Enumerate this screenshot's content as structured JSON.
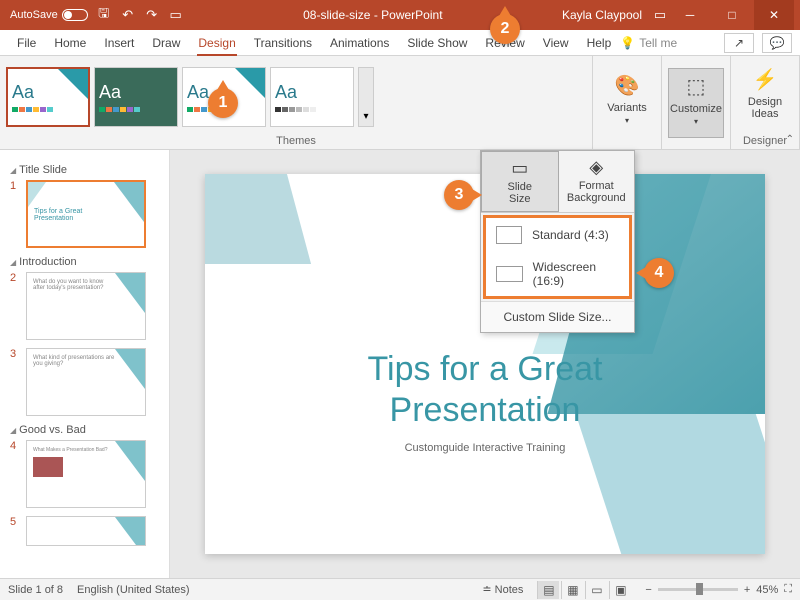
{
  "titlebar": {
    "autosave": "AutoSave",
    "doc": "08-slide-size",
    "app": "PowerPoint",
    "user": "Kayla Claypool"
  },
  "tabs": {
    "file": "File",
    "home": "Home",
    "insert": "Insert",
    "draw": "Draw",
    "design": "Design",
    "transitions": "Transitions",
    "animations": "Animations",
    "slideshow": "Slide Show",
    "review": "Review",
    "view": "View",
    "help": "Help",
    "tellme": "Tell me"
  },
  "ribbon": {
    "themes_label": "Themes",
    "variants": "Variants",
    "customize": "Customize",
    "design_ideas": "Design\nIdeas",
    "designer_label": "Designer"
  },
  "customize_menu": {
    "slide_size": "Slide\nSize",
    "format_bg": "Format\nBackground",
    "standard": "Standard (4:3)",
    "widescreen": "Widescreen (16:9)",
    "custom": "Custom Slide Size..."
  },
  "sidebar": {
    "sec1": "Title Slide",
    "sec2": "Introduction",
    "sec3": "Good vs. Bad"
  },
  "slide": {
    "title": "Tips for a Great\nPresentation",
    "subtitle": "Customguide Interactive Training"
  },
  "status": {
    "slide": "Slide 1 of 8",
    "lang": "English (United States)",
    "notes": "Notes",
    "zoom": "45%"
  },
  "callouts": {
    "c1": "1",
    "c2": "2",
    "c3": "3",
    "c4": "4"
  }
}
